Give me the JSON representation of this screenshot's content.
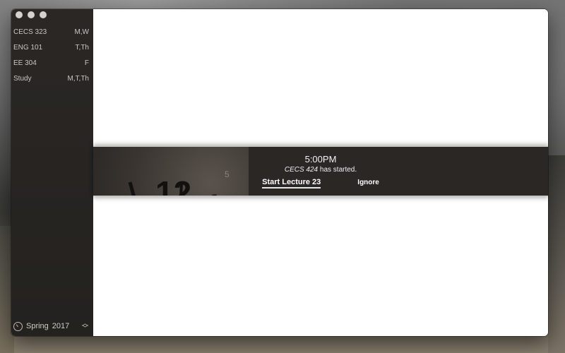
{
  "sidebar": {
    "courses": [
      {
        "name": "CECS 323",
        "days": "M,W"
      },
      {
        "name": "ENG 101",
        "days": "T,Th"
      },
      {
        "name": "EE 304",
        "days": "F"
      },
      {
        "name": "Study",
        "days": "M,T,Th"
      }
    ],
    "semester": {
      "label": "Spring",
      "year": "2017",
      "icon": "clock-icon",
      "stepper_icon": "up-down-stepper-icon"
    }
  },
  "notification": {
    "time": "5:00PM",
    "course": "CECS 424",
    "message_suffix": " has started.",
    "start_label": "Start Lecture 23",
    "ignore_label": "Ignore",
    "background_icon": "wall-clock-icon",
    "clock_numerals": [
      "12",
      "1",
      "5"
    ]
  },
  "colors": {
    "sidebar": "#2a2725",
    "banner": "#2b2724",
    "main": "#ffffff"
  }
}
